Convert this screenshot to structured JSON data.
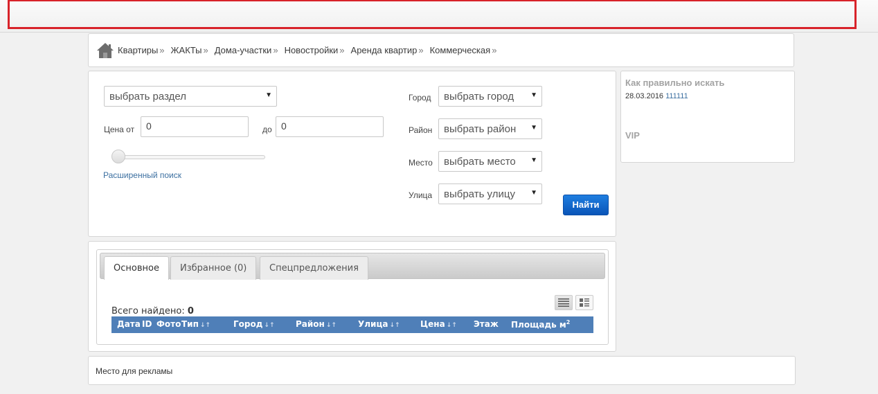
{
  "nav": {
    "items": [
      "Квартиры",
      "ЖАКТы",
      "Дома-участки",
      "Новостройки",
      "Аренда квартир",
      "Коммерческая"
    ],
    "separator": "»"
  },
  "search": {
    "section_select": "выбрать раздел",
    "price_from_label": "Цена от",
    "price_from_value": "0",
    "price_to_label": "до",
    "price_to_value": "0",
    "price_slider_value": 0,
    "advanced_link": "Расширенный поиск",
    "city_label": "Город",
    "city_select": "выбрать город",
    "district_label": "Район",
    "district_select": "выбрать район",
    "place_label": "Место",
    "place_select": "выбрать место",
    "street_label": "Улица",
    "street_select": "выбрать улицу",
    "find_button": "Найти"
  },
  "sidebar": {
    "title": "Как правильно искать",
    "date": "28.03.2016",
    "link": "111111",
    "vip": "VIP"
  },
  "results": {
    "tabs": [
      "Основное",
      "Избранное (0)",
      "Спецпредложения"
    ],
    "active_tab": 0,
    "found_label": "Всего найдено:",
    "found_count": "0",
    "columns": [
      "Дата",
      "ID",
      "Фото",
      "Тип",
      "Город",
      "Район",
      "Улица",
      "Цена",
      "Этаж",
      "Площадь м"
    ],
    "sort_glyph": "↓↑",
    "area_superscript": "2"
  },
  "ad": {
    "text": "Место для рекламы"
  },
  "colors": {
    "accent_red": "#d8232a",
    "header_blue": "#4f7fb8",
    "button_blue": "#0a55b8",
    "link_blue": "#3b6fa0"
  }
}
